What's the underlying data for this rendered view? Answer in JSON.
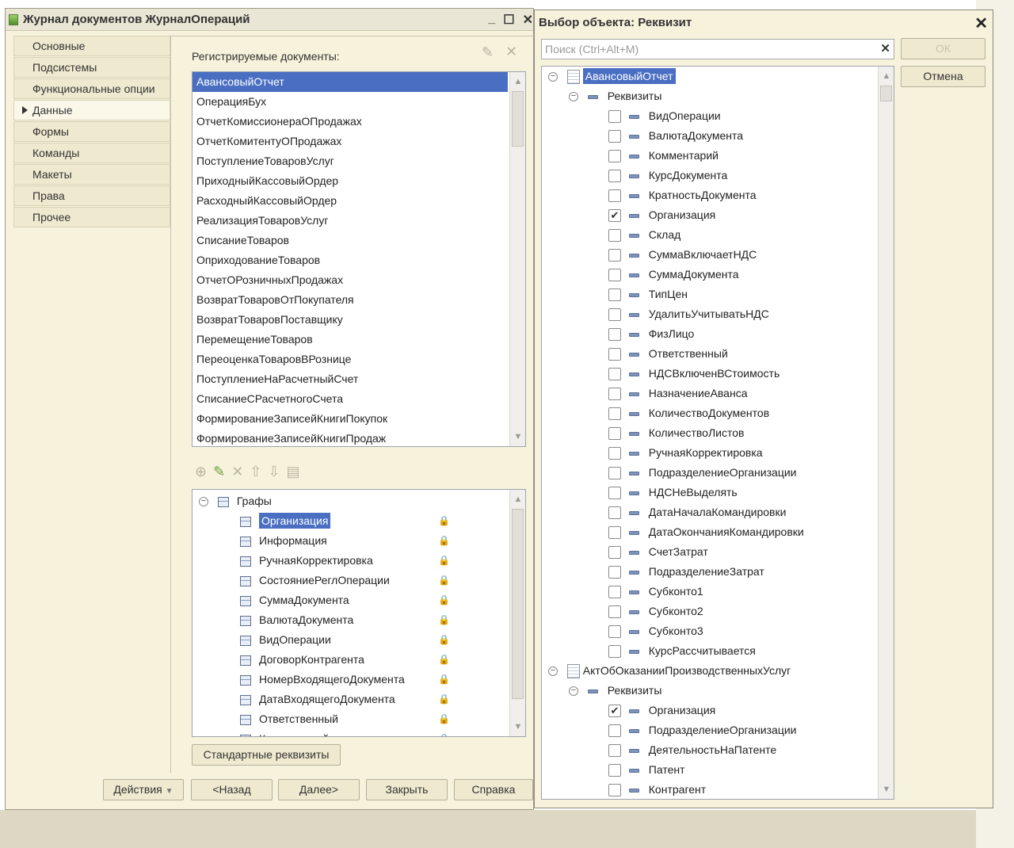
{
  "main_window": {
    "title": "Журнал документов ЖурналОпераций",
    "buttons": {
      "minimize": "_",
      "maximize": "☐",
      "close": "✕"
    }
  },
  "nav": {
    "items": [
      {
        "label": "Основные"
      },
      {
        "label": "Подсистемы"
      },
      {
        "label": "Функциональные опции"
      },
      {
        "label": "Данные",
        "active": true
      },
      {
        "label": "Формы"
      },
      {
        "label": "Команды"
      },
      {
        "label": "Макеты"
      },
      {
        "label": "Права"
      },
      {
        "label": "Прочее"
      }
    ]
  },
  "registered": {
    "label": "Регистрируемые документы:",
    "items": [
      "АвансовыйОтчет",
      "ОперацияБух",
      "ОтчетКомиссионераОПродажах",
      "ОтчетКомитентуОПродажах",
      "ПоступлениеТоваровУслуг",
      "ПриходныйКассовыйОрдер",
      "РасходныйКассовыйОрдер",
      "РеализацияТоваровУслуг",
      "СписаниеТоваров",
      "ОприходованиеТоваров",
      "ОтчетОРозничныхПродажах",
      "ВозвратТоваровОтПокупателя",
      "ВозвратТоваровПоставщику",
      "ПеремещениеТоваров",
      "ПереоценкаТоваровВРознице",
      "ПоступлениеНаРасчетныйСчет",
      "СписаниеСРасчетногоСчета",
      "ФормированиеЗаписейКнигиПокупок",
      "ФормированиеЗаписейКнигиПродаж"
    ]
  },
  "graphs": {
    "root": "Графы",
    "items": [
      "Организация",
      "Информация",
      "РучнаяКорректировка",
      "СостояниеРеглОперации",
      "СуммаДокумента",
      "ВалютаДокумента",
      "ВидОперации",
      "ДоговорКонтрагента",
      "НомерВходящегоДокумента",
      "ДатаВходящегоДокумента",
      "Ответственный",
      "Комментарий"
    ]
  },
  "std_button": "Стандартные реквизиты",
  "footer": {
    "actions": "Действия",
    "back": "<Назад",
    "next": "Далее>",
    "close": "Закрыть",
    "help": "Справка"
  },
  "dialog": {
    "title": "Выбор объекта: Реквизит",
    "search_placeholder": "Поиск (Ctrl+Alt+M)",
    "ok": "ОК",
    "cancel": "Отмена",
    "doc1": "АвансовыйОтчет",
    "group1": "Реквизиты",
    "attrs1": [
      {
        "label": "ВидОперации",
        "checked": false
      },
      {
        "label": "ВалютаДокумента",
        "checked": false
      },
      {
        "label": "Комментарий",
        "checked": false
      },
      {
        "label": "КурсДокумента",
        "checked": false
      },
      {
        "label": "КратностьДокумента",
        "checked": false
      },
      {
        "label": "Организация",
        "checked": true
      },
      {
        "label": "Склад",
        "checked": false
      },
      {
        "label": "СуммаВключаетНДС",
        "checked": false
      },
      {
        "label": "СуммаДокумента",
        "checked": false
      },
      {
        "label": "ТипЦен",
        "checked": false
      },
      {
        "label": "УдалитьУчитыватьНДС",
        "checked": false
      },
      {
        "label": "ФизЛицо",
        "checked": false
      },
      {
        "label": "Ответственный",
        "checked": false
      },
      {
        "label": "НДСВключенВСтоимость",
        "checked": false
      },
      {
        "label": "НазначениеАванса",
        "checked": false
      },
      {
        "label": "КоличествоДокументов",
        "checked": false
      },
      {
        "label": "КоличествоЛистов",
        "checked": false
      },
      {
        "label": "РучнаяКорректировка",
        "checked": false
      },
      {
        "label": "ПодразделениеОрганизации",
        "checked": false
      },
      {
        "label": "НДСНеВыделять",
        "checked": false
      },
      {
        "label": "ДатаНачалаКомандировки",
        "checked": false
      },
      {
        "label": "ДатаОкончанияКомандировки",
        "checked": false
      },
      {
        "label": "СчетЗатрат",
        "checked": false
      },
      {
        "label": "ПодразделениеЗатрат",
        "checked": false
      },
      {
        "label": "Субконто1",
        "checked": false
      },
      {
        "label": "Субконто2",
        "checked": false
      },
      {
        "label": "Субконто3",
        "checked": false
      },
      {
        "label": "КурсРассчитывается",
        "checked": false
      }
    ],
    "doc2": "АктОбОказанииПроизводственныхУслуг",
    "group2": "Реквизиты",
    "attrs2": [
      {
        "label": "Организация",
        "checked": true
      },
      {
        "label": "ПодразделениеОрганизации",
        "checked": false
      },
      {
        "label": "ДеятельностьНаПатенте",
        "checked": false
      },
      {
        "label": "Патент",
        "checked": false
      },
      {
        "label": "Контрагент",
        "checked": false
      }
    ]
  }
}
